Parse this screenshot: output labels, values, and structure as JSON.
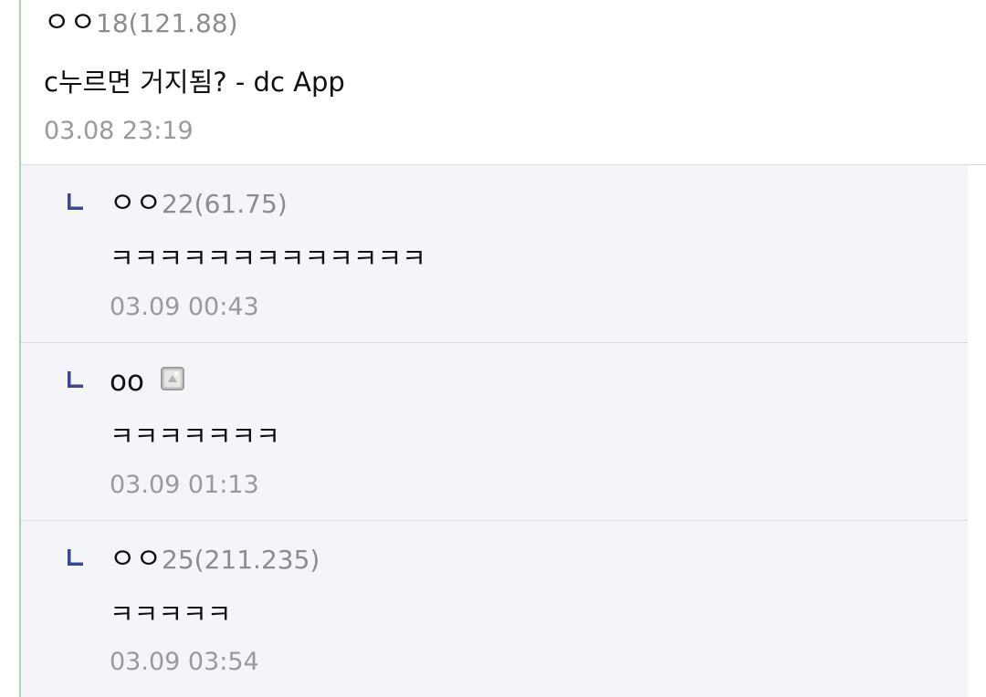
{
  "comments": [
    {
      "nickname": "ㅇㅇ",
      "ip": "18(121.88)",
      "text": "c누르면 거지됨? - dc App",
      "date": "03.08 23:19"
    }
  ],
  "replies": [
    {
      "nickname": "ㅇㅇ",
      "ip": "22(61.75)",
      "text": "ㅋㅋㅋㅋㅋㅋㅋㅋㅋㅋㅋㅋㅋ",
      "date": "03.09 00:43"
    },
    {
      "nickname": "oo",
      "ip": "",
      "text": "ㅋㅋㅋㅋㅋㅋㅋ",
      "date": "03.09 01:13",
      "icon": "fixed-nick-icon"
    },
    {
      "nickname": "ㅇㅇ",
      "ip": "25(211.235)",
      "text": "ㅋㅋㅋㅋㅋ",
      "date": "03.09 03:54"
    }
  ],
  "colors": {
    "reply_bg": "#f4f5f9",
    "reply_arrow": "#3b4890",
    "left_rule": "#a9d6ad",
    "meta_text": "#9a9a9a"
  }
}
